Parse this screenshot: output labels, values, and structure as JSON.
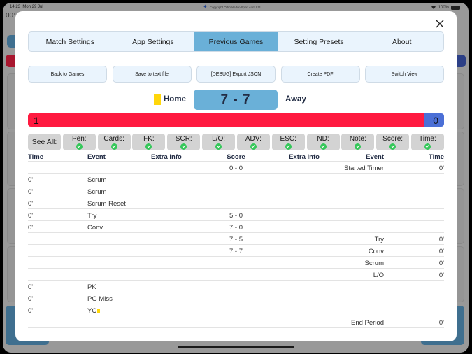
{
  "status_bar": {
    "time": "14:23",
    "date": "Mon 29 Jul",
    "copyright": "Copyright Officials-for-Sport.com Ltd.",
    "battery": "100%",
    "wifi_icon": "wifi-icon",
    "battery_icon": "battery-icon"
  },
  "background": {
    "timer_text": "00:"
  },
  "modal": {
    "close_icon": "close-icon",
    "tabs": [
      {
        "label": "Match Settings",
        "active": false
      },
      {
        "label": "App Settings",
        "active": false
      },
      {
        "label": "Previous Games",
        "active": true
      },
      {
        "label": "Setting Presets",
        "active": false
      },
      {
        "label": "About",
        "active": false
      }
    ],
    "actions": [
      {
        "label": "Back to Games"
      },
      {
        "label": "Save to text file"
      },
      {
        "label": "[DEBUG] Export JSON"
      },
      {
        "label": "Create PDF"
      },
      {
        "label": "Switch View"
      }
    ],
    "scoreboard": {
      "home": "Home",
      "away": "Away",
      "score": "7 - 7",
      "home_card_color": "#ffd60a"
    },
    "possession": {
      "home_value": "1",
      "away_value": "0",
      "home_fraction": 0.952,
      "home_color": "#ff1a40",
      "away_color": "#4b6fd6"
    },
    "filters": {
      "see_all_label": "See All:",
      "items": [
        {
          "label": "Pen:",
          "checked": true
        },
        {
          "label": "Cards:",
          "checked": true
        },
        {
          "label": "FK:",
          "checked": true
        },
        {
          "label": "SCR:",
          "checked": true
        },
        {
          "label": "L/O:",
          "checked": true
        },
        {
          "label": "ADV:",
          "checked": true
        },
        {
          "label": "ESC:",
          "checked": true
        },
        {
          "label": "ND:",
          "checked": true
        },
        {
          "label": "Note:",
          "checked": true
        },
        {
          "label": "Score:",
          "checked": true
        },
        {
          "label": "Time:",
          "checked": true
        }
      ]
    },
    "table": {
      "headers": {
        "time_left": "Time",
        "event_left": "Event",
        "extra_left": "Extra Info",
        "score": "Score",
        "extra_right": "Extra Info",
        "event_right": "Event",
        "time_right": "Time"
      },
      "rows": [
        {
          "time_l": "",
          "event_l": "",
          "extra_l": "",
          "score": "0 - 0",
          "extra_r": "",
          "event_r": "Started Timer",
          "time_r": "0'"
        },
        {
          "time_l": "0'",
          "event_l": "Scrum",
          "extra_l": "",
          "score": "",
          "extra_r": "",
          "event_r": "",
          "time_r": ""
        },
        {
          "time_l": "0'",
          "event_l": "Scrum",
          "extra_l": "",
          "score": "",
          "extra_r": "",
          "event_r": "",
          "time_r": ""
        },
        {
          "time_l": "0'",
          "event_l": "Scrum Reset",
          "extra_l": "",
          "score": "",
          "extra_r": "",
          "event_r": "",
          "time_r": ""
        },
        {
          "time_l": "0'",
          "event_l": "Try",
          "extra_l": "",
          "score": "5 - 0",
          "extra_r": "",
          "event_r": "",
          "time_r": ""
        },
        {
          "time_l": "0'",
          "event_l": "Conv",
          "extra_l": "",
          "score": "7 - 0",
          "extra_r": "",
          "event_r": "",
          "time_r": ""
        },
        {
          "time_l": "",
          "event_l": "",
          "extra_l": "",
          "score": "7 - 5",
          "extra_r": "",
          "event_r": "Try",
          "time_r": "0'"
        },
        {
          "time_l": "",
          "event_l": "",
          "extra_l": "",
          "score": "7 - 7",
          "extra_r": "",
          "event_r": "Conv",
          "time_r": "0'"
        },
        {
          "time_l": "",
          "event_l": "",
          "extra_l": "",
          "score": "",
          "extra_r": "",
          "event_r": "Scrum",
          "time_r": "0'"
        },
        {
          "time_l": "",
          "event_l": "",
          "extra_l": "",
          "score": "",
          "extra_r": "",
          "event_r": "L/O",
          "time_r": "0'"
        },
        {
          "time_l": "0'",
          "event_l": "PK",
          "extra_l": "",
          "score": "",
          "extra_r": "",
          "event_r": "",
          "time_r": ""
        },
        {
          "time_l": "0'",
          "event_l": "PG Miss",
          "extra_l": "",
          "score": "",
          "extra_r": "",
          "event_r": "",
          "time_r": ""
        },
        {
          "time_l": "0'",
          "event_l": "YC",
          "extra_l": "",
          "score": "",
          "extra_r": "",
          "event_r": "",
          "time_r": "",
          "card": "yellow"
        },
        {
          "time_l": "",
          "event_l": "",
          "extra_l": "",
          "score": "",
          "extra_r": "",
          "event_r": "End Period",
          "time_r": "0'"
        }
      ]
    }
  }
}
